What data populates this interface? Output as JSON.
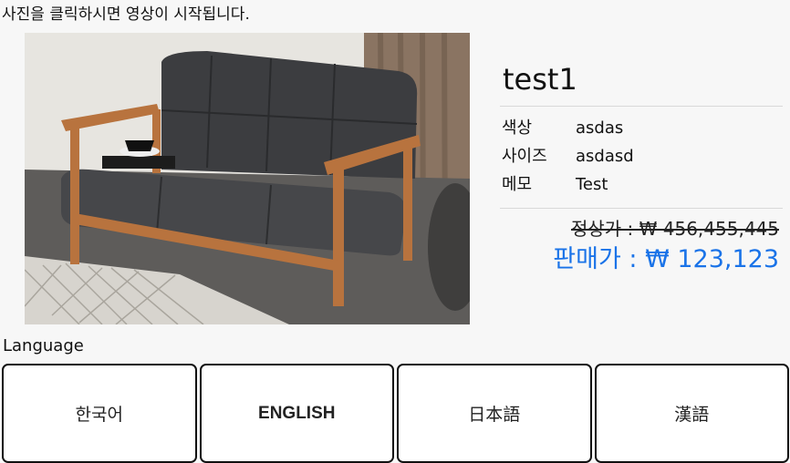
{
  "hint_text": "사진을 클릭하시면 영상이 시작됩니다.",
  "product": {
    "name": "test1",
    "specs": [
      {
        "label": "색상",
        "value": "asdas"
      },
      {
        "label": "사이즈",
        "value": "asdasd"
      },
      {
        "label": "메모",
        "value": "Test"
      }
    ],
    "regular_price": "정상가 : ₩ 456,455,445",
    "sale_price": "판매가 : ₩ 123,123"
  },
  "language": {
    "label": "Language",
    "options": [
      "한국어",
      "ENGLISH",
      "日本語",
      "漢語"
    ]
  },
  "colors": {
    "sale_price": "#1a73e8",
    "background": "#f7f7f7"
  }
}
